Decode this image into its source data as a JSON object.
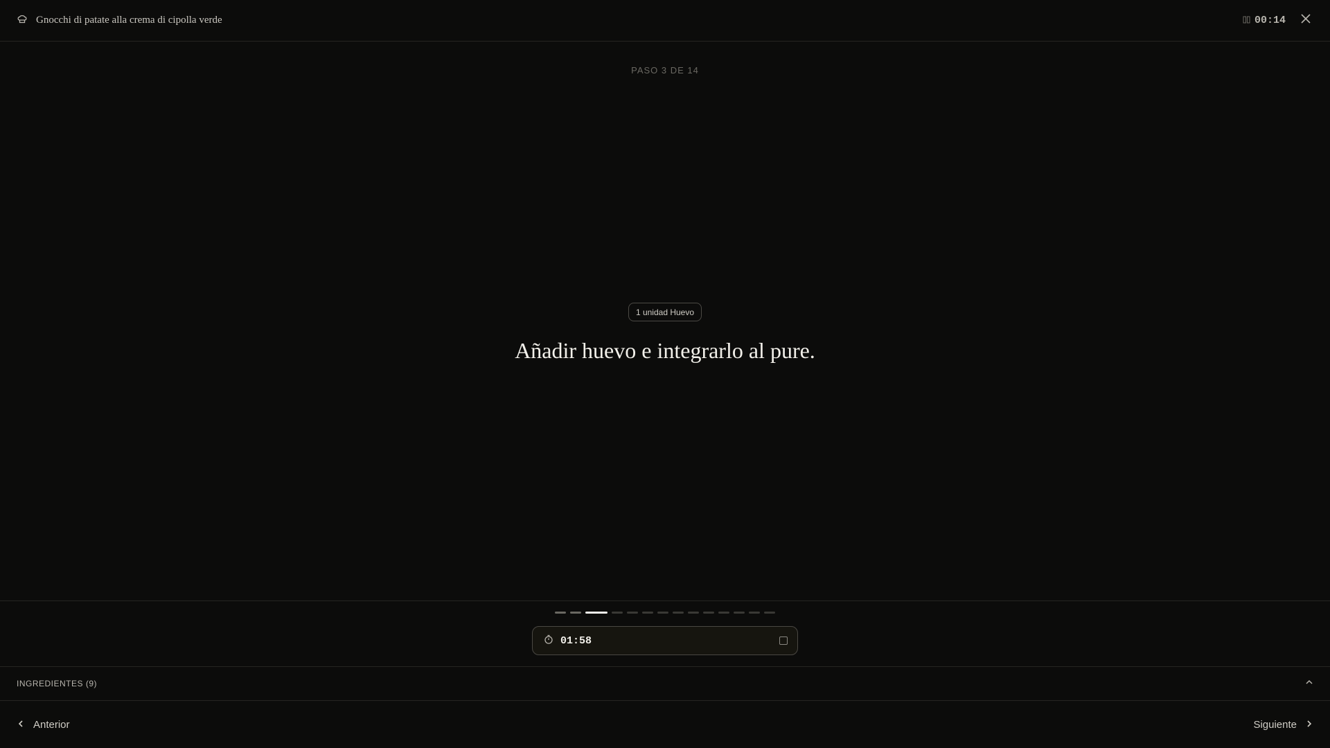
{
  "header": {
    "recipe_title": "Gnocchi di patate alla crema di cipolla verde",
    "elapsed_time": "00:14"
  },
  "step": {
    "counter_label": "PASO 3 DE 14",
    "current": 3,
    "total": 14,
    "ingredient_chip": "1 unidad Huevo",
    "instruction": "Añadir huevo e integrarlo al pure."
  },
  "timer": {
    "value": "01:58"
  },
  "ingredients": {
    "label": "INGREDIENTES (9)"
  },
  "footer": {
    "prev_label": "Anterior",
    "next_label": "Siguiente"
  },
  "icons": {
    "recipe": "chef-hat-icon",
    "elapsed": "clock-icon",
    "close": "close-icon",
    "timer": "stopwatch-icon",
    "stop": "stop-icon",
    "collapse": "chevron-up-icon",
    "prev": "chevron-left-icon",
    "next": "chevron-right-icon"
  },
  "colors": {
    "background": "#0c0c0b",
    "active_progress": "#f2f0ea",
    "inactive_progress": "#3a3935"
  }
}
